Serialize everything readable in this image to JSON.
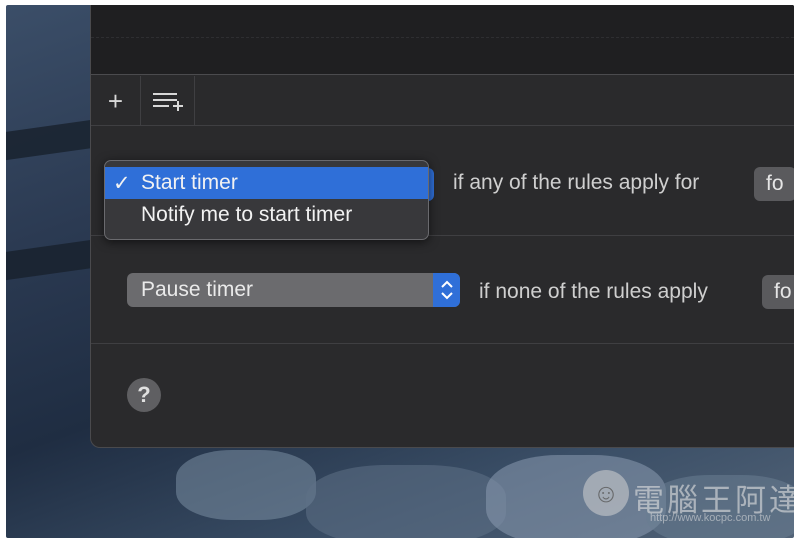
{
  "toolbar": {
    "add_glyph": "+",
    "add_group_icon": "list-plus-icon"
  },
  "rule_start": {
    "menu_items": [
      {
        "label": "Start timer",
        "selected": true,
        "check": "✓"
      },
      {
        "label": "Notify me to start timer",
        "selected": false
      }
    ],
    "condition_label": "if any of the rules apply for",
    "trailing_button": "fo"
  },
  "rule_pause": {
    "action_label": "Pause timer",
    "condition_label": "if none of the rules apply",
    "trailing_button": "fo"
  },
  "help": {
    "glyph": "?"
  },
  "watermark": {
    "title": "電腦王阿達",
    "url": "http://www.kocpc.com.tw"
  },
  "colors": {
    "accent": "#2f6fd8",
    "window_bg": "#2a2a2c"
  }
}
